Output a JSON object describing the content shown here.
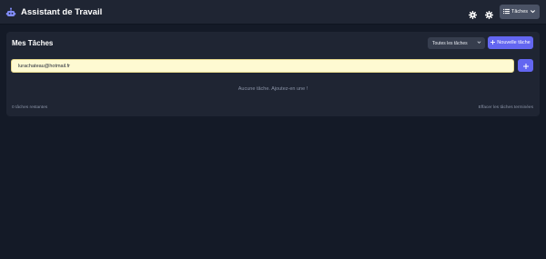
{
  "header": {
    "app_title": "Assistant de Travail",
    "tasks_menu_label": "Tâches",
    "icons": {
      "brand": "robot-icon",
      "settings": "gear-icon",
      "theme": "gear-icon",
      "menu": "list-icon",
      "dropdown": "chevron-down-icon"
    }
  },
  "tasks": {
    "title": "Mes Tâches",
    "filter": {
      "selected": "Toutes les tâches"
    },
    "new_task_label": "Nouvelle tâche",
    "input": {
      "value": "lurachateau@hotmail.fr",
      "placeholder": ""
    },
    "empty_message": "Aucune tâche. Ajoutez-en une !",
    "remaining_text": "0 tâches restantes",
    "clear_completed_label": "Effacer les tâches terminées"
  },
  "colors": {
    "background": "#141a27",
    "panel": "#1f2533",
    "accent": "#6366f1",
    "input_background": "#fefad2"
  }
}
